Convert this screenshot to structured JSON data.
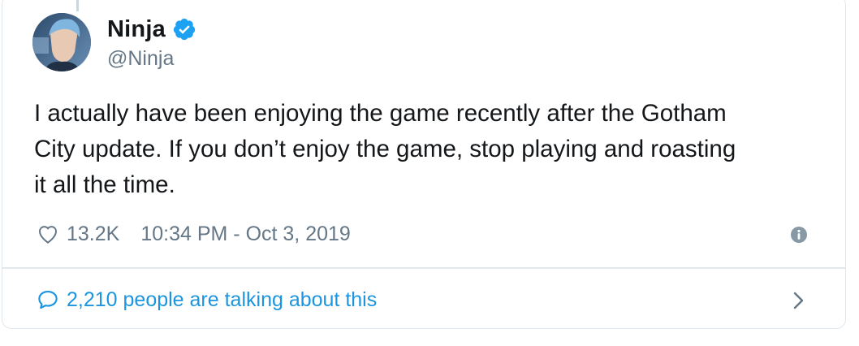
{
  "author": {
    "display_name": "Ninja",
    "handle": "@Ninja",
    "verified": true
  },
  "tweet": {
    "lines": [
      "I actually have been enjoying the game recently after the Gotham",
      "City update. If you don’t enjoy the game, stop playing and roasting",
      "it all the time."
    ]
  },
  "meta": {
    "likes": "13.2K",
    "timestamp": "10:34 PM - Oct 3, 2019"
  },
  "conversation": {
    "label": "2,210 people are talking about this"
  },
  "icons": {
    "verified": "verified-badge-icon",
    "like": "heart-icon",
    "info": "info-icon",
    "reply": "speech-bubble-icon",
    "expand": "chevron-right-icon"
  },
  "colors": {
    "text_primary": "#14171a",
    "text_secondary": "#657786",
    "link_blue": "#1b95e0",
    "verified_blue": "#1da1f2",
    "border": "#e1e8ed"
  }
}
